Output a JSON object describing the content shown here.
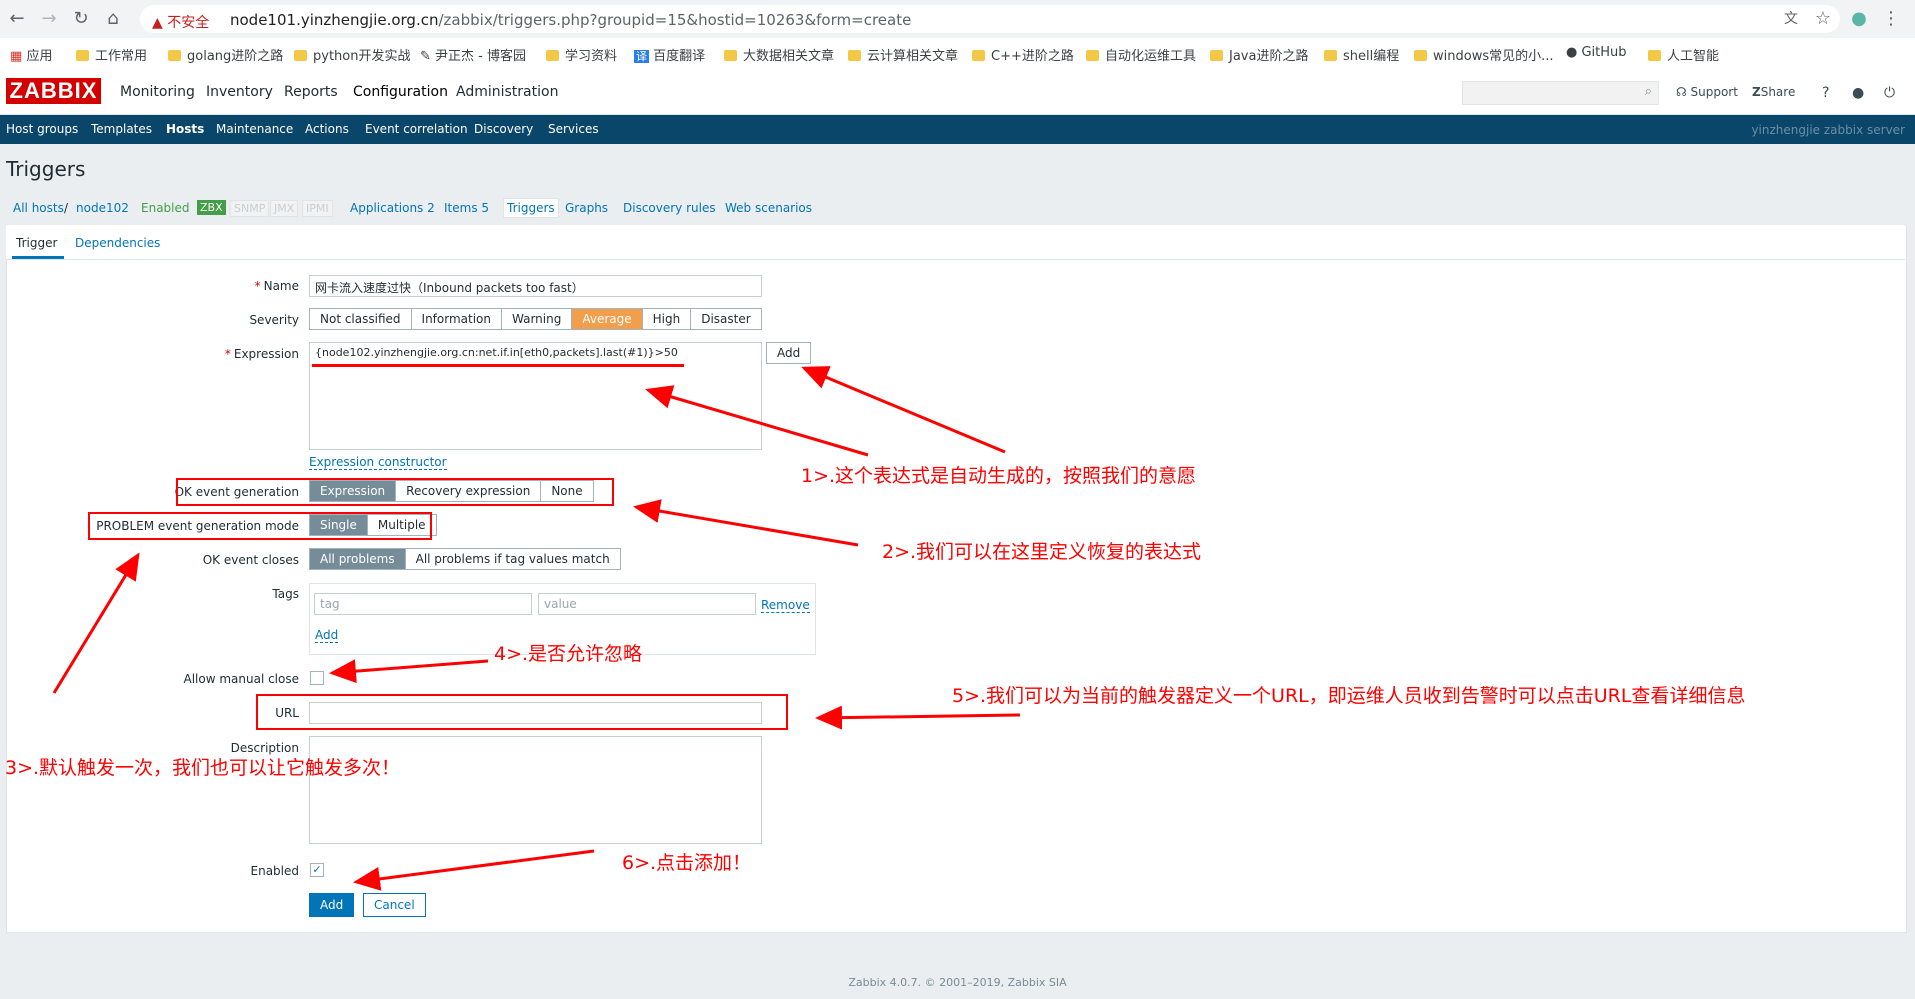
{
  "browser": {
    "insecure_label": "不安全",
    "url_host": "node101.yinzhengjie.org.cn",
    "url_path": "/zabbix/triggers.php?groupid=15&hostid=10263&form=create",
    "bookmarks": [
      "应用",
      "工作常用",
      "golang进阶之路",
      "python开发实战",
      "尹正杰 - 博客园",
      "学习资料",
      "百度翻译",
      "大数据相关文章",
      "云计算相关文章",
      "C++进阶之路",
      "自动化运维工具",
      "Java进阶之路",
      "shell编程",
      "windows常见的小...",
      "GitHub",
      "人工智能"
    ]
  },
  "header": {
    "logo": "ZABBIX",
    "menu": [
      "Monitoring",
      "Inventory",
      "Reports",
      "Configuration",
      "Administration"
    ],
    "support": "Support",
    "share": "Share",
    "help": "?",
    "submenu": [
      "Host groups",
      "Templates",
      "Hosts",
      "Maintenance",
      "Actions",
      "Event correlation",
      "Discovery",
      "Services"
    ],
    "server_name": "yinzhengjie zabbix server"
  },
  "page": {
    "title": "Triggers",
    "hostnav": {
      "all_hosts": "All hosts",
      "sep": "/",
      "host": "node102",
      "status": "Enabled",
      "badges": [
        "ZBX",
        "SNMP",
        "JMX",
        "IPMI"
      ],
      "applications": "Applications 2",
      "items": "Items 5",
      "triggers": "Triggers",
      "graphs": "Graphs",
      "discovery": "Discovery rules",
      "web": "Web scenarios"
    },
    "tabs": [
      "Trigger",
      "Dependencies"
    ]
  },
  "form": {
    "name_label": "Name",
    "name_value": "网卡流入速度过快（Inbound packets too fast）",
    "severity_label": "Severity",
    "severity": [
      "Not classified",
      "Information",
      "Warning",
      "Average",
      "High",
      "Disaster"
    ],
    "expression_label": "Expression",
    "expression_value": "{node102.yinzhengjie.org.cn:net.if.in[eth0,packets].last(#1)}>50",
    "add_button": "Add",
    "expression_constructor": "Expression constructor",
    "ok_event_label": "OK event generation",
    "ok_event": [
      "Expression",
      "Recovery expression",
      "None"
    ],
    "problem_mode_label": "PROBLEM event generation mode",
    "problem_mode": [
      "Single",
      "Multiple"
    ],
    "ok_closes_label": "OK event closes",
    "ok_closes": [
      "All problems",
      "All problems if tag values match"
    ],
    "tags_label": "Tags",
    "tag_placeholder": "tag",
    "value_placeholder": "value",
    "remove": "Remove",
    "tags_add": "Add",
    "manual_close_label": "Allow manual close",
    "url_label": "URL",
    "description_label": "Description",
    "enabled_label": "Enabled",
    "submit": "Add",
    "cancel": "Cancel"
  },
  "annotations": [
    "1>.这个表达式是自动生成的，按照我们的意愿",
    "2>.我们可以在这里定义恢复的表达式",
    "3>.默认触发一次，我们也可以让它触发多次！",
    "4>.是否允许忽略",
    "5>.我们可以为当前的触发器定义一个URL，即运维人员收到告警时可以点击URL查看详细信息",
    "6>.点击添加！"
  ],
  "footer": "Zabbix 4.0.7. © 2001–2019, Zabbix SIA"
}
